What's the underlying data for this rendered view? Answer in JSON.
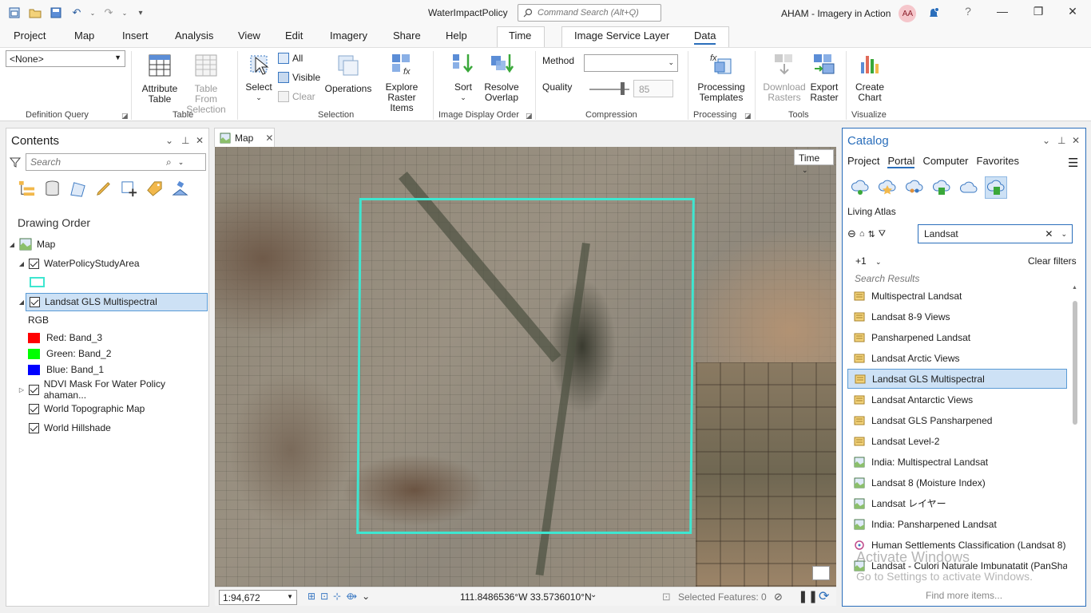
{
  "app": {
    "project_name": "WaterImpactPolicy",
    "command_search_placeholder": "Command Search (Alt+Q)",
    "user": "AHAM - Imagery in Action",
    "user_initials": "AA",
    "help": "?"
  },
  "ribbon_tabs": [
    "Project",
    "Map",
    "Insert",
    "Analysis",
    "View",
    "Edit",
    "Imagery",
    "Share",
    "Help",
    "Time",
    "Image Service Layer",
    "Data"
  ],
  "active_tab": "Data",
  "ribbon": {
    "definition_query": {
      "value": "<None>",
      "group": "Definition Query"
    },
    "table": {
      "attribute_table": "Attribute\nTable",
      "table_from_selection": "Table From\nSelection",
      "group": "Table"
    },
    "selection": {
      "select": "Select",
      "all": "All",
      "visible": "Visible",
      "clear": "Clear",
      "operations": "Operations",
      "explore": "Explore\nRaster Items",
      "group": "Selection"
    },
    "image_display_order": {
      "sort": "Sort",
      "resolve_overlap": "Resolve\nOverlap",
      "group": "Image Display Order"
    },
    "compression": {
      "method_label": "Method",
      "method_value": "",
      "quality_label": "Quality",
      "quality_value": "85",
      "group": "Compression"
    },
    "processing": {
      "templates": "Processing\nTemplates",
      "group": "Processing"
    },
    "tools": {
      "download": "Download\nRasters",
      "export": "Export\nRaster",
      "group": "Tools"
    },
    "visualize": {
      "create_chart": "Create\nChart",
      "group": "Visualize"
    }
  },
  "contents": {
    "title": "Contents",
    "search_placeholder": "Search",
    "drawing_order": "Drawing Order",
    "map_label": "Map",
    "layers": [
      {
        "name": "WaterPolicyStudyArea"
      },
      {
        "name": "Landsat GLS Multispectral"
      },
      {
        "name": "NDVI Mask For Water Policy ahaman..."
      },
      {
        "name": "World Topographic Map"
      },
      {
        "name": "World Hillshade"
      }
    ],
    "rgb_label": "RGB",
    "bands": [
      {
        "label": "Red:  Band_3",
        "color": "#ff0000"
      },
      {
        "label": "Green: Band_2",
        "color": "#00ff00"
      },
      {
        "label": "Blue:  Band_1",
        "color": "#0000ff"
      }
    ]
  },
  "map": {
    "tab_label": "Map",
    "time_button": "Time",
    "scale": "1:94,672",
    "coordinates": "111.8486536°W 33.5736010°N",
    "selected_features": "Selected Features: 0",
    "study_area_color": "#3ee6d0"
  },
  "catalog": {
    "title": "Catalog",
    "tabs": [
      "Project",
      "Portal",
      "Computer",
      "Favorites"
    ],
    "active_tab": "Portal",
    "section": "Living Atlas",
    "search_value": "Landsat",
    "filter_count": "+1",
    "clear_filters": "Clear filters",
    "search_results_label": "Search Results",
    "results": [
      {
        "name": "Multispectral Landsat",
        "icon": "image-service-icon"
      },
      {
        "name": "Landsat 8-9 Views",
        "icon": "image-service-icon"
      },
      {
        "name": "Pansharpened Landsat",
        "icon": "image-service-icon"
      },
      {
        "name": "Landsat Arctic Views",
        "icon": "image-service-icon"
      },
      {
        "name": "Landsat GLS Multispectral",
        "icon": "image-service-icon"
      },
      {
        "name": "Landsat Antarctic Views",
        "icon": "image-service-icon"
      },
      {
        "name": "Landsat GLS Pansharpened",
        "icon": "image-service-icon"
      },
      {
        "name": "Landsat Level-2",
        "icon": "image-service-icon"
      },
      {
        "name": "India: Multispectral Landsat",
        "icon": "map-image-icon"
      },
      {
        "name": "Landsat 8 (Moisture Index)",
        "icon": "map-image-icon"
      },
      {
        "name": "Landsat レイヤー",
        "icon": "map-image-icon"
      },
      {
        "name": "India: Pansharpened Landsat",
        "icon": "map-image-icon"
      },
      {
        "name": "Human Settlements Classification (Landsat 8)",
        "icon": "tool-icon"
      },
      {
        "name": "Landsat - Culori Naturale Imbunatatit (PanSharpened)",
        "icon": "map-image-icon"
      }
    ],
    "find_more": "Find more items...",
    "activate_windows_1": "Activate Windows",
    "activate_windows_2": "Go to Settings to activate Windows."
  }
}
